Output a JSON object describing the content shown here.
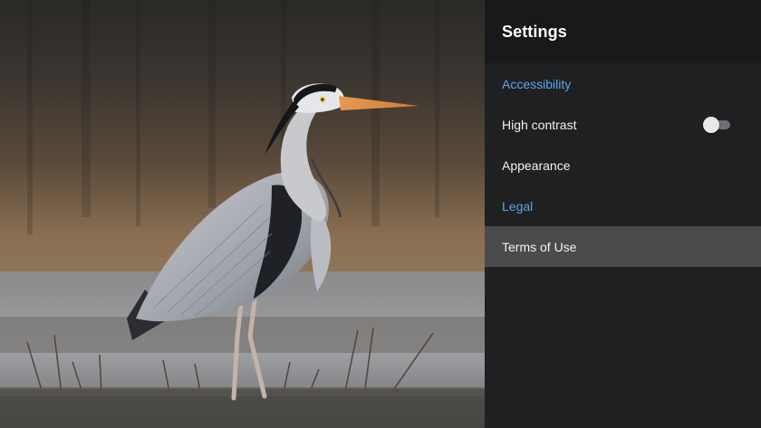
{
  "background": {
    "subject": "grey heron standing in shallow water"
  },
  "settings": {
    "title": "Settings",
    "sections": [
      {
        "label": "Accessibility",
        "items": [
          {
            "label": "High contrast",
            "control": "toggle",
            "checked": false
          },
          {
            "label": "Appearance"
          }
        ]
      },
      {
        "label": "Legal",
        "items": [
          {
            "label": "Terms of Use",
            "selected": true
          }
        ]
      }
    ]
  },
  "colors": {
    "accent": "#5aa6ea",
    "panel_bg": "#1f2022",
    "header_bg": "#18191a",
    "selected_bg": "#4a4b4d"
  }
}
